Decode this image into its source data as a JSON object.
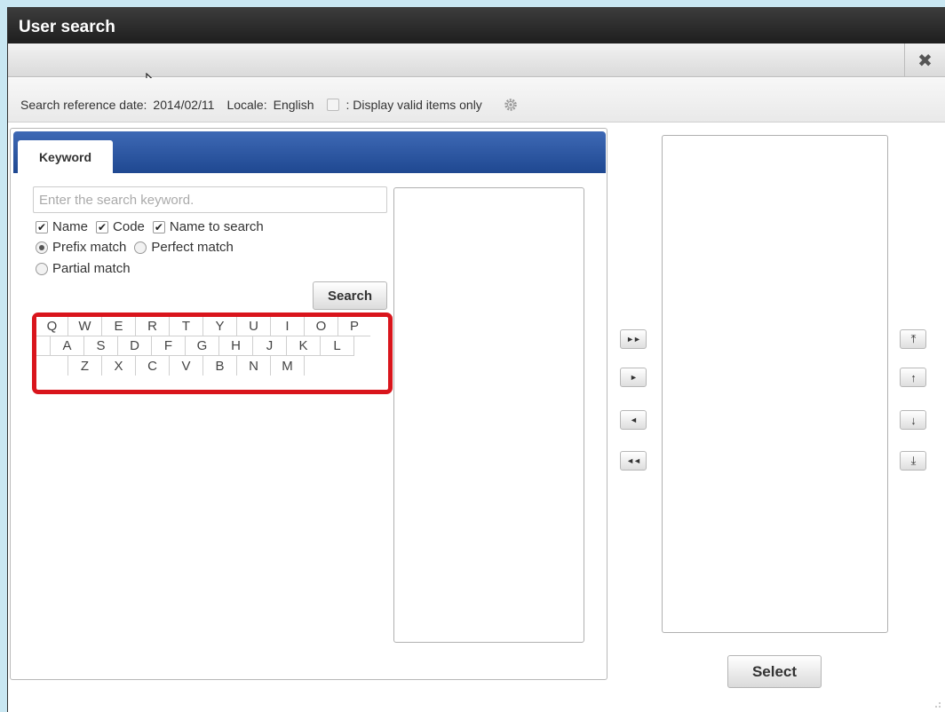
{
  "window": {
    "title": "User search",
    "close_symbol": "✖"
  },
  "info_bar": {
    "ref_date_label": "Search reference date:",
    "ref_date_value": "2014/02/11",
    "locale_label": "Locale:",
    "locale_value": "English",
    "valid_only_label": ": Display valid items only"
  },
  "tabs": [
    {
      "label": "Keyword",
      "active": true
    }
  ],
  "search": {
    "placeholder": "Enter the search keyword.",
    "checkboxes": [
      {
        "label": "Name",
        "checked": true
      },
      {
        "label": "Code",
        "checked": true
      },
      {
        "label": "Name to search",
        "checked": true
      }
    ],
    "match_modes": [
      {
        "label": "Prefix match",
        "selected": true
      },
      {
        "label": "Perfect match",
        "selected": false
      },
      {
        "label": "Partial match",
        "selected": false
      }
    ],
    "button_label": "Search"
  },
  "keyboard": {
    "rows": [
      [
        "Q",
        "W",
        "E",
        "R",
        "T",
        "Y",
        "U",
        "I",
        "O",
        "P"
      ],
      [
        "A",
        "S",
        "D",
        "F",
        "G",
        "H",
        "J",
        "K",
        "L"
      ],
      [
        "Z",
        "X",
        "C",
        "V",
        "B",
        "N",
        "M"
      ]
    ]
  },
  "transfer_buttons": [
    {
      "name": "add-all-button",
      "glyph": "►►"
    },
    {
      "name": "add-button",
      "glyph": "►"
    },
    {
      "name": "remove-button",
      "glyph": "◄"
    },
    {
      "name": "remove-all-button",
      "glyph": "◄◄"
    }
  ],
  "order_buttons": [
    {
      "name": "move-top-button",
      "glyph": "⤒"
    },
    {
      "name": "move-up-button",
      "glyph": "↑"
    },
    {
      "name": "move-down-button",
      "glyph": "↓"
    },
    {
      "name": "move-bottom-button",
      "glyph": "⤓"
    }
  ],
  "select_button_label": "Select",
  "colors": {
    "accent": "#2a55a3",
    "highlight": "#d9151c",
    "titlebar": "#2b2b2b"
  }
}
